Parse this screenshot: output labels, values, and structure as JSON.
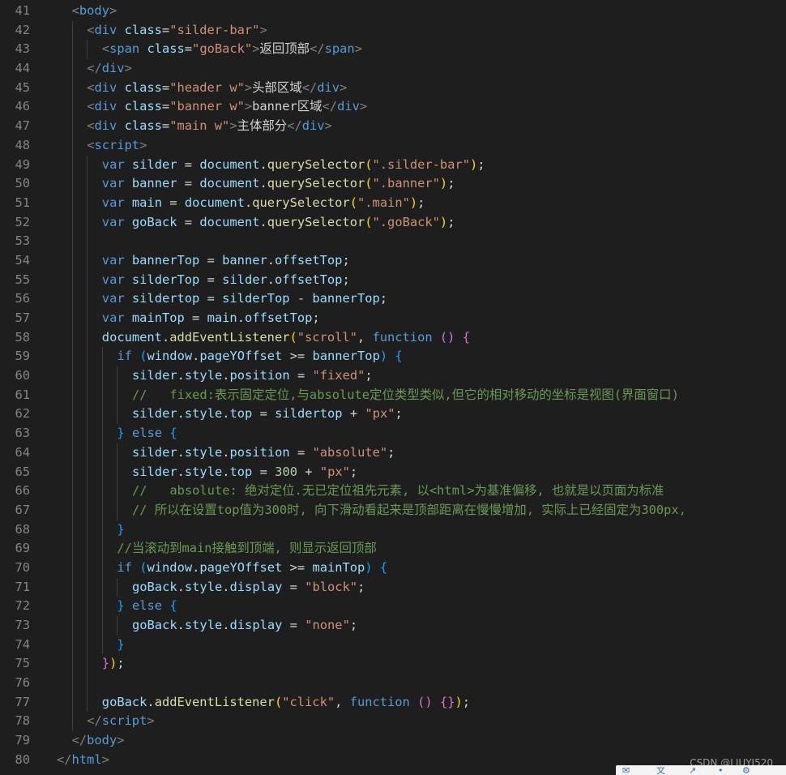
{
  "editor": {
    "lines": [
      {
        "no": "41",
        "indent": 1,
        "html": "<span class='p'>&lt;</span><span class='t'>body</span><span class='p'>&gt;</span>"
      },
      {
        "no": "42",
        "indent": 2,
        "html": "<span class='p'>&lt;</span><span class='t'>div</span> <span class='a'>class</span><span class='x'>=</span><span class='s'>\"silder-bar\"</span><span class='p'>&gt;</span>"
      },
      {
        "no": "43",
        "indent": 3,
        "html": "<span class='p'>&lt;</span><span class='t'>span</span> <span class='a'>class</span><span class='x'>=</span><span class='s'>\"goBack\"</span><span class='p'>&gt;</span><span class='x'>返回顶部</span><span class='p'>&lt;/</span><span class='t'>span</span><span class='p'>&gt;</span>"
      },
      {
        "no": "44",
        "indent": 2,
        "html": "<span class='p'>&lt;/</span><span class='t'>div</span><span class='p'>&gt;</span>"
      },
      {
        "no": "45",
        "indent": 2,
        "html": "<span class='p'>&lt;</span><span class='t'>div</span> <span class='a'>class</span><span class='x'>=</span><span class='s'>\"header w\"</span><span class='p'>&gt;</span><span class='x'>头部区域</span><span class='p'>&lt;/</span><span class='t'>div</span><span class='p'>&gt;</span>"
      },
      {
        "no": "46",
        "indent": 2,
        "html": "<span class='p'>&lt;</span><span class='t'>div</span> <span class='a'>class</span><span class='x'>=</span><span class='s'>\"banner w\"</span><span class='p'>&gt;</span><span class='x'>banner区域</span><span class='p'>&lt;/</span><span class='t'>div</span><span class='p'>&gt;</span>"
      },
      {
        "no": "47",
        "indent": 2,
        "html": "<span class='p'>&lt;</span><span class='t'>div</span> <span class='a'>class</span><span class='x'>=</span><span class='s'>\"main w\"</span><span class='p'>&gt;</span><span class='x'>主体部分</span><span class='p'>&lt;/</span><span class='t'>div</span><span class='p'>&gt;</span>"
      },
      {
        "no": "48",
        "indent": 2,
        "html": "<span class='p'>&lt;</span><span class='t'>script</span><span class='p'>&gt;</span>"
      },
      {
        "no": "49",
        "indent": 3,
        "html": "<span class='k'>var</span> <span class='a'>silder</span> <span class='x'>=</span> <span class='a'>document</span><span class='x'>.</span><span class='f'>querySelector</span><span class='y'>(</span><span class='s'>\".silder-bar\"</span><span class='y'>)</span><span class='x'>;</span>"
      },
      {
        "no": "50",
        "indent": 3,
        "html": "<span class='k'>var</span> <span class='a'>banner</span> <span class='x'>=</span> <span class='a'>document</span><span class='x'>.</span><span class='f'>querySelector</span><span class='y'>(</span><span class='s'>\".banner\"</span><span class='y'>)</span><span class='x'>;</span>"
      },
      {
        "no": "51",
        "indent": 3,
        "html": "<span class='k'>var</span> <span class='a'>main</span> <span class='x'>=</span> <span class='a'>document</span><span class='x'>.</span><span class='f'>querySelector</span><span class='y'>(</span><span class='s'>\".main\"</span><span class='y'>)</span><span class='x'>;</span>"
      },
      {
        "no": "52",
        "indent": 3,
        "html": "<span class='k'>var</span> <span class='a'>goBack</span> <span class='x'>=</span> <span class='a'>document</span><span class='x'>.</span><span class='f'>querySelector</span><span class='y'>(</span><span class='s'>\".goBack\"</span><span class='y'>)</span><span class='x'>;</span>"
      },
      {
        "no": "53",
        "indent": 3,
        "html": ""
      },
      {
        "no": "54",
        "indent": 3,
        "html": "<span class='k'>var</span> <span class='a'>bannerTop</span> <span class='x'>=</span> <span class='a'>banner</span><span class='x'>.</span><span class='a'>offsetTop</span><span class='x'>;</span>"
      },
      {
        "no": "55",
        "indent": 3,
        "html": "<span class='k'>var</span> <span class='a'>silderTop</span> <span class='x'>=</span> <span class='a'>silder</span><span class='x'>.</span><span class='a'>offsetTop</span><span class='x'>;</span>"
      },
      {
        "no": "56",
        "indent": 3,
        "html": "<span class='k'>var</span> <span class='a'>sildertop</span> <span class='x'>=</span> <span class='a'>silderTop</span> <span class='x'>-</span> <span class='a'>bannerTop</span><span class='x'>;</span>"
      },
      {
        "no": "57",
        "indent": 3,
        "html": "<span class='k'>var</span> <span class='a'>mainTop</span> <span class='x'>=</span> <span class='a'>main</span><span class='x'>.</span><span class='a'>offsetTop</span><span class='x'>;</span>"
      },
      {
        "no": "58",
        "indent": 3,
        "html": "<span class='a'>document</span><span class='x'>.</span><span class='f'>addEventListener</span><span class='y'>(</span><span class='s'>\"scroll\"</span><span class='x'>,</span> <span class='k'>function</span> <span class='m'>()</span> <span class='m'>{</span>"
      },
      {
        "no": "59",
        "indent": 4,
        "html": "<span class='k'>if</span> <span class='b'>(</span><span class='a'>window</span><span class='x'>.</span><span class='a'>pageYOffset</span> <span class='x'>&gt;=</span> <span class='a'>bannerTop</span><span class='b'>)</span> <span class='b'>{</span>"
      },
      {
        "no": "60",
        "indent": 5,
        "html": "<span class='a'>silder</span><span class='x'>.</span><span class='a'>style</span><span class='x'>.</span><span class='a'>position</span> <span class='x'>=</span> <span class='s'>\"fixed\"</span><span class='x'>;</span>"
      },
      {
        "no": "61",
        "indent": 5,
        "html": "<span class='c'>//   fixed:表示固定定位,与absolute定位类型类似,但它的相对移动的坐标是视图(界面窗口)</span>"
      },
      {
        "no": "62",
        "indent": 5,
        "html": "<span class='a'>silder</span><span class='x'>.</span><span class='a'>style</span><span class='x'>.</span><span class='a'>top</span> <span class='x'>=</span> <span class='a'>sildertop</span> <span class='x'>+</span> <span class='s'>\"px\"</span><span class='x'>;</span>"
      },
      {
        "no": "63",
        "indent": 4,
        "html": "<span class='b'>}</span> <span class='k'>else</span> <span class='b'>{</span>"
      },
      {
        "no": "64",
        "indent": 5,
        "html": "<span class='a'>silder</span><span class='x'>.</span><span class='a'>style</span><span class='x'>.</span><span class='a'>position</span> <span class='x'>=</span> <span class='s'>\"absolute\"</span><span class='x'>;</span>"
      },
      {
        "no": "65",
        "indent": 5,
        "html": "<span class='a'>silder</span><span class='x'>.</span><span class='a'>style</span><span class='x'>.</span><span class='a'>top</span> <span class='x'>=</span> <span class='n'>300</span> <span class='x'>+</span> <span class='s'>\"px\"</span><span class='x'>;</span>"
      },
      {
        "no": "66",
        "indent": 5,
        "html": "<span class='c'>//   absolute: 绝对定位.无已定位祖先元素, 以&lt;html&gt;为基准偏移, 也就是以页面为标准</span>"
      },
      {
        "no": "67",
        "indent": 5,
        "html": "<span class='c'>// 所以在设置top值为300时, 向下滑动看起来是顶部距离在慢慢增加, 实际上已经固定为300px,</span>"
      },
      {
        "no": "68",
        "indent": 4,
        "html": "<span class='b'>}</span>"
      },
      {
        "no": "69",
        "indent": 4,
        "html": "<span class='c'>//当滚动到main接触到顶端, 则显示返回顶部</span>"
      },
      {
        "no": "70",
        "indent": 4,
        "html": "<span class='k'>if</span> <span class='b'>(</span><span class='a'>window</span><span class='x'>.</span><span class='a'>pageYOffset</span> <span class='x'>&gt;=</span> <span class='a'>mainTop</span><span class='b'>)</span> <span class='b'>{</span>"
      },
      {
        "no": "71",
        "indent": 5,
        "html": "<span class='a'>goBack</span><span class='x'>.</span><span class='a'>style</span><span class='x'>.</span><span class='a'>display</span> <span class='x'>=</span> <span class='s'>\"block\"</span><span class='x'>;</span>"
      },
      {
        "no": "72",
        "indent": 4,
        "html": "<span class='b'>}</span> <span class='k'>else</span> <span class='b'>{</span>"
      },
      {
        "no": "73",
        "indent": 5,
        "html": "<span class='a'>goBack</span><span class='x'>.</span><span class='a'>style</span><span class='x'>.</span><span class='a'>display</span> <span class='x'>=</span> <span class='s'>\"none\"</span><span class='x'>;</span>"
      },
      {
        "no": "74",
        "indent": 4,
        "html": "<span class='b'>}</span>"
      },
      {
        "no": "75",
        "indent": 3,
        "html": "<span class='m'>}</span><span class='y'>)</span><span class='x'>;</span>"
      },
      {
        "no": "76",
        "indent": 3,
        "html": ""
      },
      {
        "no": "77",
        "indent": 3,
        "html": "<span class='a'>goBack</span><span class='x'>.</span><span class='f'>addEventListener</span><span class='y'>(</span><span class='s'>\"click\"</span><span class='x'>,</span> <span class='k'>function</span> <span class='m'>()</span> <span class='m'>{}</span><span class='y'>)</span><span class='x'>;</span>"
      },
      {
        "no": "78",
        "indent": 2,
        "html": "<span class='p'>&lt;/</span><span class='t'>script</span><span class='p'>&gt;</span>"
      },
      {
        "no": "79",
        "indent": 1,
        "html": "<span class='p'>&lt;/</span><span class='t'>body</span><span class='p'>&gt;</span>"
      },
      {
        "no": "80",
        "indent": 0,
        "html": "<span class='p'>&lt;/</span><span class='t'>html</span><span class='p'>&gt;</span>"
      }
    ]
  },
  "watermark": "CSDN @LIUYJ520"
}
